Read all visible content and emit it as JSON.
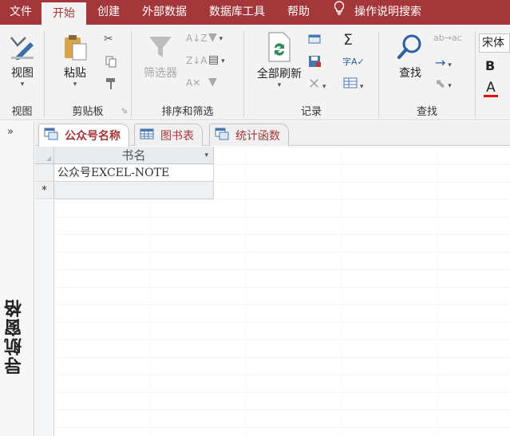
{
  "ribbon_tabs": [
    "文件",
    "开始",
    "创建",
    "外部数据",
    "数据库工具",
    "帮助"
  ],
  "tell_me": "操作说明搜索",
  "groups": {
    "view": {
      "button": "视图",
      "label": "视图"
    },
    "clipboard": {
      "button": "粘贴",
      "label": "剪贴板"
    },
    "sort_filter": {
      "button": "筛选器",
      "label": "排序和筛选"
    },
    "records": {
      "button": "全部刷新",
      "label": "记录"
    },
    "find": {
      "button": "查找",
      "label": "查找"
    },
    "text": {
      "font": "宋体",
      "bold": "B",
      "font_color": "A"
    }
  },
  "nav_pane": {
    "toggle": "»",
    "title": "导航窗格"
  },
  "doc_tabs": [
    "公众号名称",
    "图书表",
    "统计函数"
  ],
  "table": {
    "column": "书名",
    "rows": [
      "公众号EXCEL-NOTE"
    ],
    "new_row_marker": "*"
  },
  "colors": {
    "accent": "#a4373a",
    "ribbon_bg": "#f3f3f3"
  }
}
